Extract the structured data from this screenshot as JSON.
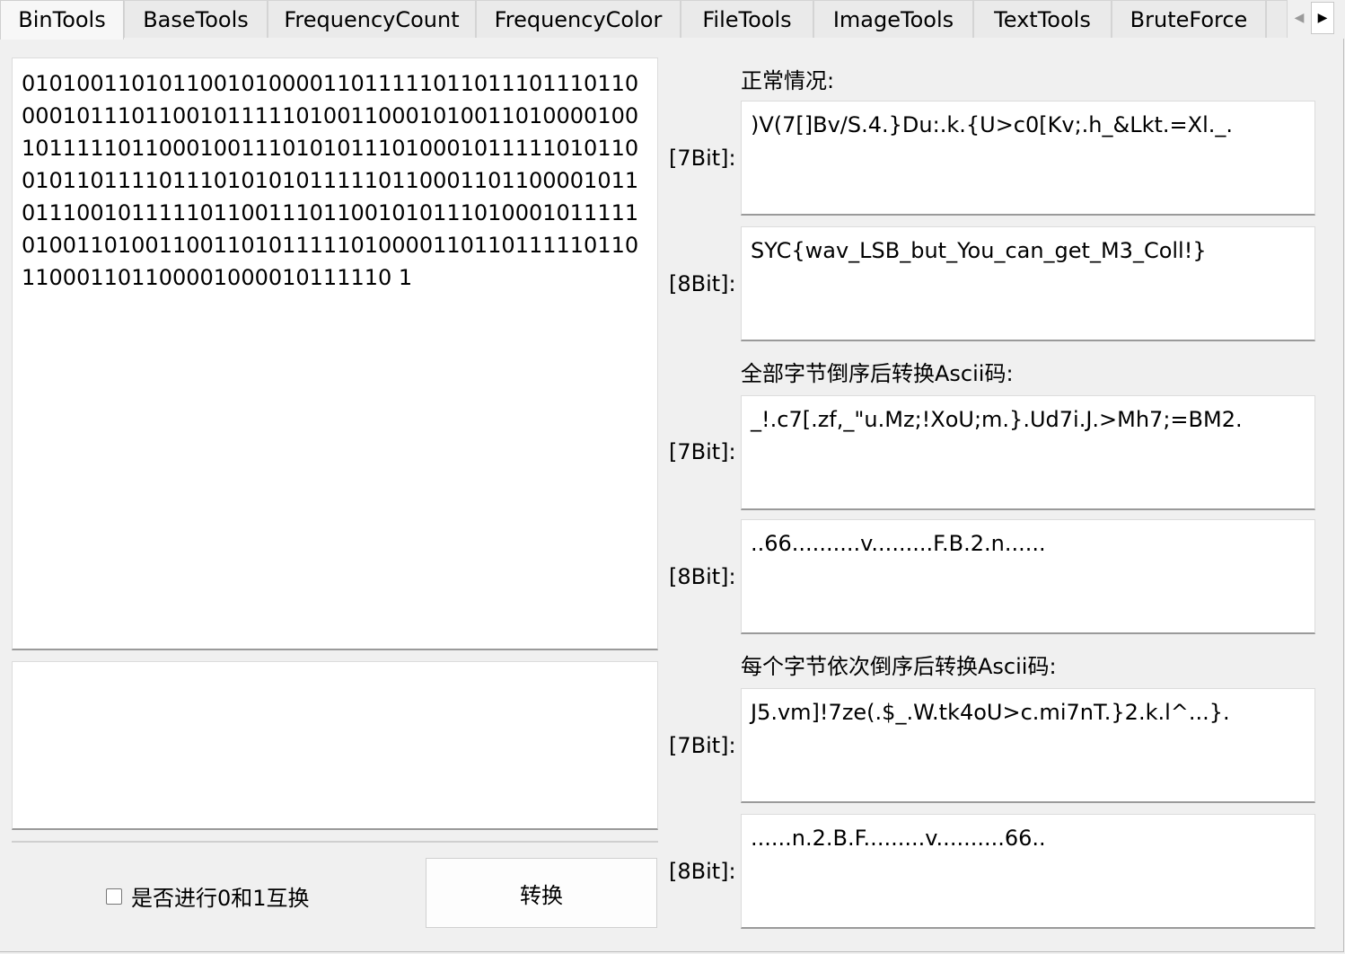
{
  "tabs": [
    {
      "label": "BinTools"
    },
    {
      "label": "BaseTools"
    },
    {
      "label": "FrequencyCount"
    },
    {
      "label": "FrequencyColor"
    },
    {
      "label": "FileTools"
    },
    {
      "label": "ImageTools"
    },
    {
      "label": "TextTools"
    },
    {
      "label": "BruteForce"
    }
  ],
  "input": {
    "binary": "010100110101100101000011011111011011101110110000101110110010111110100110001010011010000100101111101100010011101010111010001011111010110010110111101110101010111110110001101100001011011100101111101100111011001010111010001011111010011010011001101011111010000110110111110110110001101100001000010111110 1"
  },
  "output": {
    "value": ""
  },
  "options": {
    "swap_label": "是否进行0和1互换",
    "convert_label": "转换"
  },
  "sections": {
    "normal": {
      "title": "正常情况:",
      "bit7_label": "[7Bit]:",
      "bit7": ")V(7[]Bv/S.4.}Du:.k.{U>c0[Kv;.h_&Lkt.=Xl._.",
      "bit8_label": "[8Bit]:",
      "bit8": "SYC{wav_LSB_but_You_can_get_M3_Coll!}"
    },
    "all_reversed": {
      "title": "全部字节倒序后转换Ascii码:",
      "bit7_label": "[7Bit]:",
      "bit7": "_!.c7[.zf,_\"u.Mz;!XoU;m.}.Ud7i.J.>Mh7;=BM2.",
      "bit8_label": "[8Bit]:",
      "bit8": "..66..........v.........F.B.2.n......"
    },
    "each_reversed": {
      "title": "每个字节依次倒序后转换Ascii码:",
      "bit7_label": "[7Bit]:",
      "bit7": "J5.vm]!7ze(.$_.W.tk4oU>c.mi7nT.}2.k.l^...}.",
      "bit8_label": "[8Bit]:",
      "bit8": "......n.2.B.F.........v..........66.."
    }
  }
}
